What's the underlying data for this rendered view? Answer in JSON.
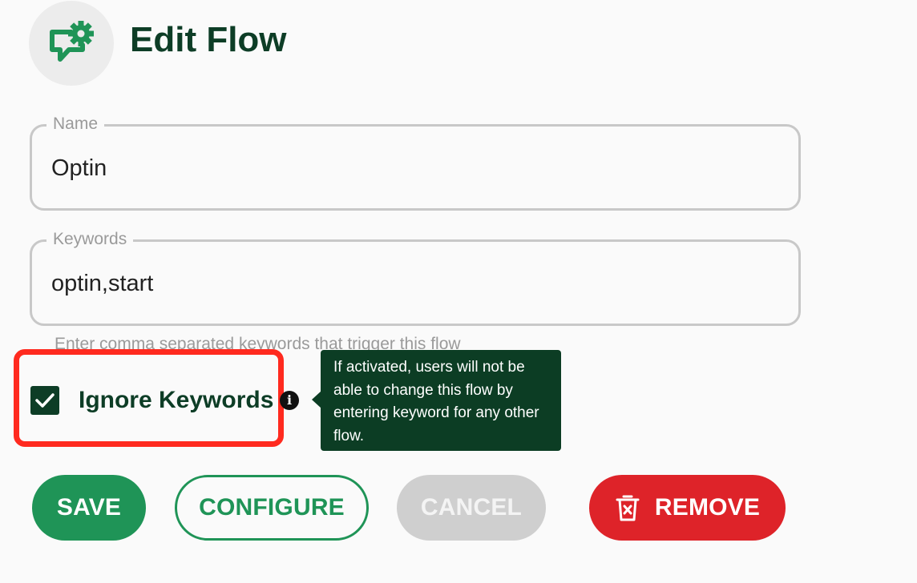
{
  "header": {
    "title": "Edit Flow",
    "icon": "flow-settings-icon"
  },
  "form": {
    "name": {
      "label": "Name",
      "value": "Optin"
    },
    "keywords": {
      "label": "Keywords",
      "value": "optin,start",
      "helper": "Enter comma separated keywords that trigger this flow"
    },
    "ignore_keywords": {
      "label": "Ignore Keywords",
      "checked": true,
      "info_icon": "info-icon",
      "tooltip": "If activated, users will not be able to change this flow by entering keyword for any other flow."
    }
  },
  "actions": {
    "save_label": "SAVE",
    "configure_label": "CONFIGURE",
    "cancel_label": "CANCEL",
    "remove_label": "REMOVE",
    "remove_icon": "trash-icon"
  },
  "colors": {
    "primary": "#1f9457",
    "dark_green": "#0d3d26",
    "danger": "#de2329",
    "highlight": "#ff2a1f",
    "disabled": "#cfcfcf"
  }
}
